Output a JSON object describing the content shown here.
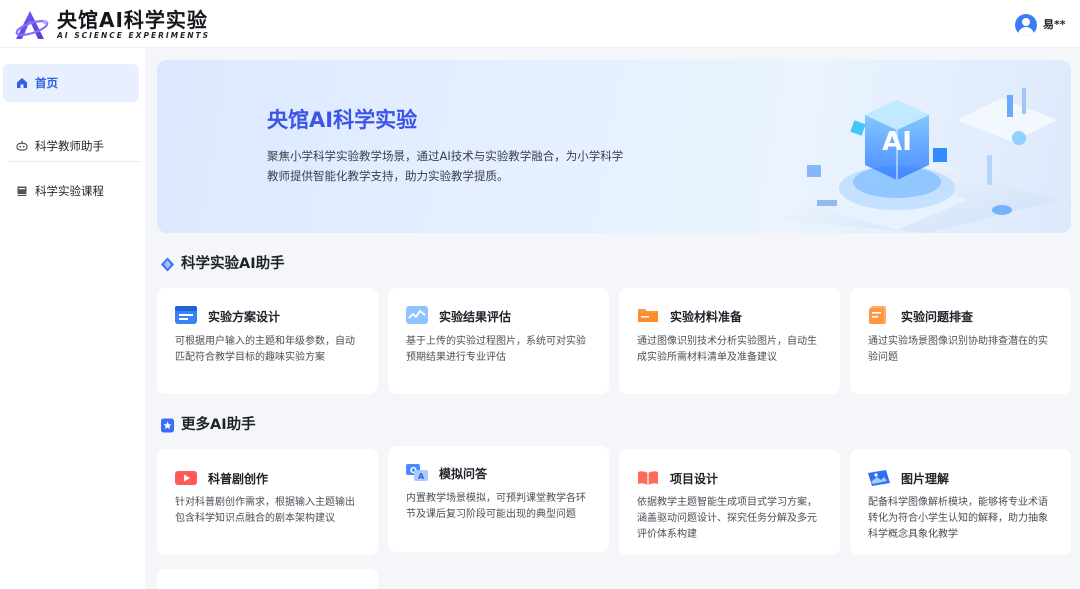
{
  "header": {
    "brand_title": "央馆AI科学实验",
    "brand_subtitle": "AI SCIENCE EXPERIMENTS",
    "username": "易**"
  },
  "sidebar": {
    "items": [
      {
        "label": "首页",
        "icon": "home-icon",
        "active": true
      },
      {
        "label": "科学教师助手",
        "icon": "robot-icon",
        "active": false
      },
      {
        "label": "科学实验课程",
        "icon": "book-icon",
        "active": false
      }
    ]
  },
  "banner": {
    "title": "央馆AI科学实验",
    "description": "聚焦小学科学实验教学场景，通过AI技术与实验教学融合，为小学科学教师提供智能化教学支持，助力实验教学提质。",
    "art_label": "AI"
  },
  "sections": [
    {
      "title": "科学实验AI助手",
      "icon": "diamond-icon",
      "cards": [
        {
          "title": "实验方案设计",
          "icon": "document-icon",
          "desc": "可根据用户输入的主题和年级参数，自动匹配符合教学目标的趣味实验方案"
        },
        {
          "title": "实验结果评估",
          "icon": "chart-icon",
          "desc": "基于上传的实验过程图片，系统可对实验预期结果进行专业评估"
        },
        {
          "title": "实验材料准备",
          "icon": "folder-icon",
          "desc": "通过图像识别技术分析实验图片，自动生成实验所需材料清单及准备建议"
        },
        {
          "title": "实验问题排查",
          "icon": "notes-icon",
          "desc": "通过实验场景图像识别协助排查潜在的实验问题"
        }
      ]
    },
    {
      "title": "更多AI助手",
      "icon": "star-badge-icon",
      "cards": [
        {
          "title": "科普剧创作",
          "icon": "video-icon",
          "desc": "针对科普剧创作需求，根据输入主题输出包含科学知识点融合的剧本架构建议"
        },
        {
          "title": "模拟问答",
          "icon": "qa-icon",
          "desc": "内置教学场景模拟，可预判课堂教学各环节及课后复习阶段可能出现的典型问题"
        },
        {
          "title": "项目设计",
          "icon": "open-book-icon",
          "desc": "依据教学主题智能生成项目式学习方案，涵盖驱动问题设计、探究任务分解及多元评价体系构建"
        },
        {
          "title": "图片理解",
          "icon": "image-icon",
          "desc": "配备科学图像解析模块，能够将专业术语转化为符合小学生认知的解释，助力抽象科学概念具象化教学"
        }
      ]
    }
  ],
  "colors": {
    "accent": "#2f5fe3",
    "banner_title": "#3d55e6",
    "active_nav_bg": "#e8efff",
    "page_bg": "#f4f6fa"
  }
}
